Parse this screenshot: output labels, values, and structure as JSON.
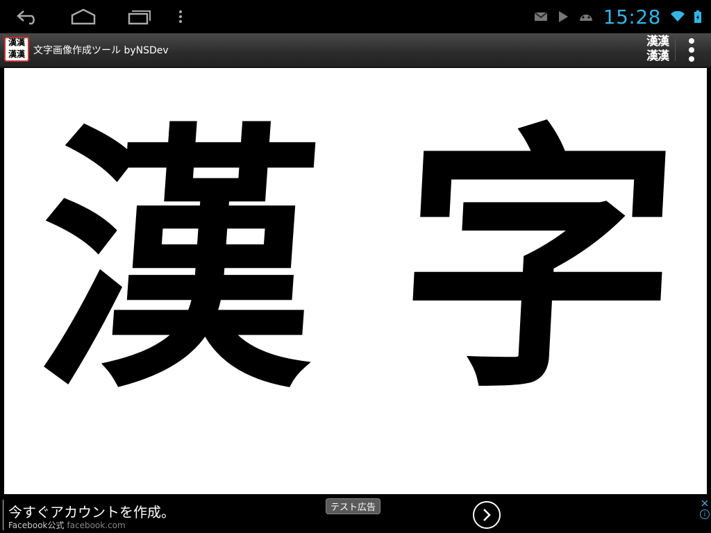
{
  "system_bar": {
    "clock": "15:28",
    "icons": [
      "back-icon",
      "home-icon",
      "recent-apps-icon",
      "menu-dots-icon",
      "gmail-icon",
      "play-store-icon",
      "android-icon",
      "wifi-icon",
      "battery-icon"
    ]
  },
  "action_bar": {
    "app_icon_text": "漢漢漢漢",
    "title": "文字画像作成ツール byNSDev",
    "kanji_button": "漢漢漢漢"
  },
  "canvas": {
    "characters": [
      "漢",
      "字"
    ]
  },
  "ad": {
    "headline": "今すぐアカウントを作成。",
    "advertiser": "Facebook公式",
    "domain": "facebook.com",
    "test_badge": "テスト広告",
    "info": "i"
  },
  "colors": {
    "clock": "#33b5e5",
    "canvas_background": "#ffffff",
    "glyph": "#000000"
  }
}
